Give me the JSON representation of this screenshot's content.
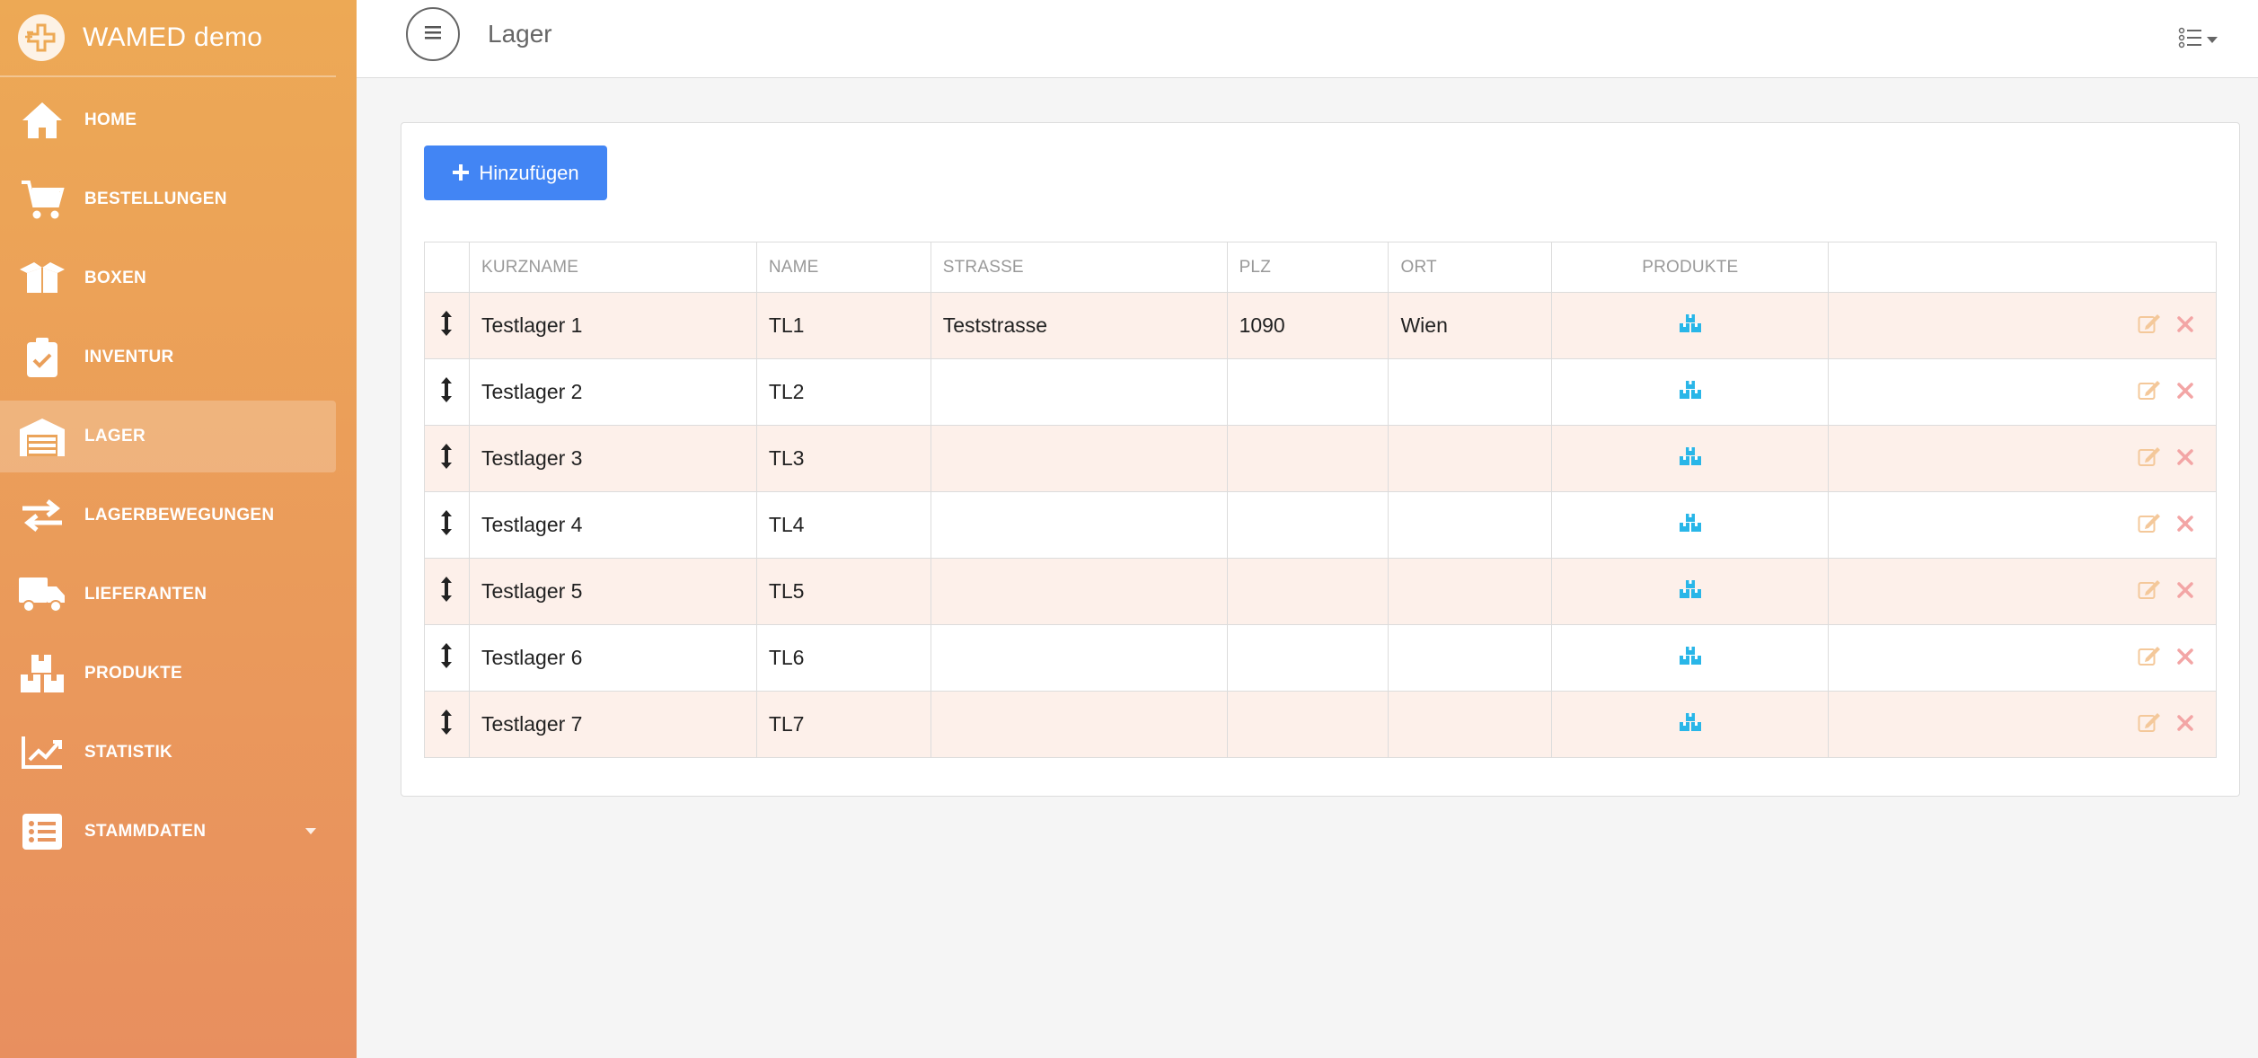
{
  "app": {
    "title": "WAMED demo"
  },
  "sidebar": {
    "items": [
      {
        "label": "HOME",
        "icon": "home-icon",
        "active": false
      },
      {
        "label": "BESTELLUNGEN",
        "icon": "cart-icon",
        "active": false
      },
      {
        "label": "BOXEN",
        "icon": "box-open-icon",
        "active": false
      },
      {
        "label": "INVENTUR",
        "icon": "clipboard-check-icon",
        "active": false
      },
      {
        "label": "LAGER",
        "icon": "warehouse-icon",
        "active": true
      },
      {
        "label": "LAGERBEWEGUNGEN",
        "icon": "exchange-arrows-icon",
        "active": false
      },
      {
        "label": "LIEFERANTEN",
        "icon": "truck-icon",
        "active": false
      },
      {
        "label": "PRODUKTE",
        "icon": "boxes-icon",
        "active": false
      },
      {
        "label": "STATISTIK",
        "icon": "chart-line-icon",
        "active": false
      },
      {
        "label": "STAMMDATEN",
        "icon": "list-alt-icon",
        "active": false,
        "has_submenu": true
      }
    ]
  },
  "header": {
    "title": "Lager",
    "view_icon": "list-view-icon"
  },
  "toolbar": {
    "add_label": "Hinzufügen"
  },
  "table": {
    "columns": [
      "",
      "KURZNAME",
      "NAME",
      "STRASSE",
      "PLZ",
      "ORT",
      "PRODUKTE",
      ""
    ],
    "rows": [
      {
        "kurzname": "Testlager 1",
        "name": "TL1",
        "strasse": "Teststrasse",
        "plz": "1090",
        "ort": "Wien"
      },
      {
        "kurzname": "Testlager 2",
        "name": "TL2",
        "strasse": "",
        "plz": "",
        "ort": ""
      },
      {
        "kurzname": "Testlager 3",
        "name": "TL3",
        "strasse": "",
        "plz": "",
        "ort": ""
      },
      {
        "kurzname": "Testlager 4",
        "name": "TL4",
        "strasse": "",
        "plz": "",
        "ort": ""
      },
      {
        "kurzname": "Testlager 5",
        "name": "TL5",
        "strasse": "",
        "plz": "",
        "ort": ""
      },
      {
        "kurzname": "Testlager 6",
        "name": "TL6",
        "strasse": "",
        "plz": "",
        "ort": ""
      },
      {
        "kurzname": "Testlager 7",
        "name": "TL7",
        "strasse": "",
        "plz": "",
        "ort": ""
      }
    ]
  },
  "colors": {
    "sidebar_top": "#eda955",
    "sidebar_bottom": "#e88f5f",
    "primary_button": "#4285f4",
    "row_stripe": "#fdf0ea",
    "products_icon": "#29b6e8",
    "edit_icon": "#f4c89a",
    "delete_icon": "#f3a5a5"
  }
}
